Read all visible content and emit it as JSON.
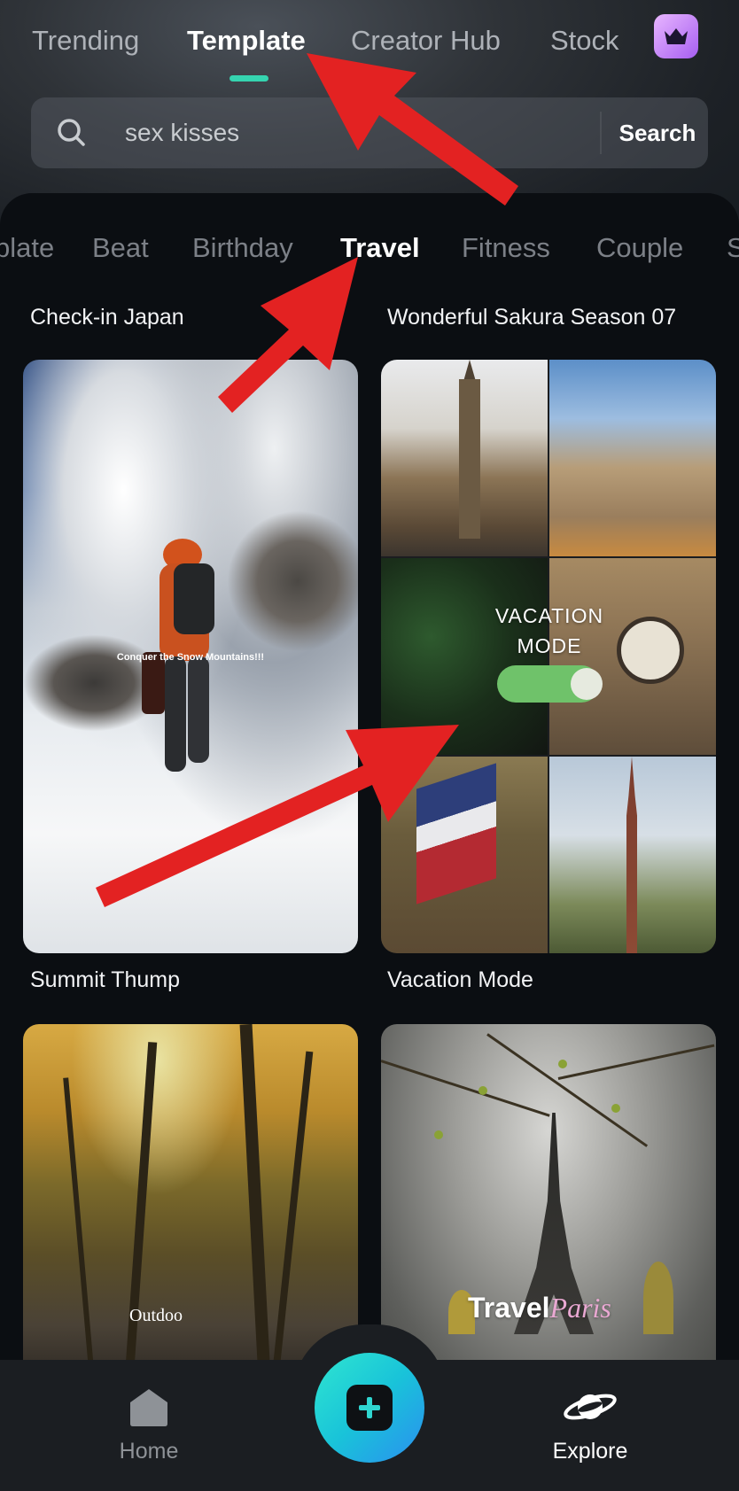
{
  "top_tabs": [
    {
      "label": "Trending"
    },
    {
      "label": "Template"
    },
    {
      "label": "Creator Hub"
    },
    {
      "label": "Stock"
    }
  ],
  "premium_icon": "crown-icon",
  "search": {
    "value": "sex kisses",
    "button_label": "Search"
  },
  "category_tabs": [
    {
      "label": "plate"
    },
    {
      "label": "Beat"
    },
    {
      "label": "Birthday"
    },
    {
      "label": "Travel"
    },
    {
      "label": "Fitness"
    },
    {
      "label": "Couple"
    },
    {
      "label": "S"
    }
  ],
  "templates": [
    {
      "title": "Check-in Japan"
    },
    {
      "title": "Wonderful Sakura Season 07"
    },
    {
      "title": "Summit Thump",
      "thumb_caption": "Conquer the Snow Mountains!!!"
    },
    {
      "title": "Vacation Mode",
      "thumb_caption": "VACATION MODE"
    },
    {
      "thumb_caption": "Outdoo"
    },
    {
      "thumb_caption_a": "Travel",
      "thumb_caption_b": "Paris"
    }
  ],
  "bottom_nav": {
    "home_label": "Home",
    "explore_label": "Explore",
    "home_icon": "home-icon",
    "create_icon": "plus-icon",
    "explore_icon": "planet-icon"
  },
  "colors": {
    "accent": "#35d4b0",
    "annotation_arrow": "#e32222",
    "create_button": "#19c3d9"
  }
}
